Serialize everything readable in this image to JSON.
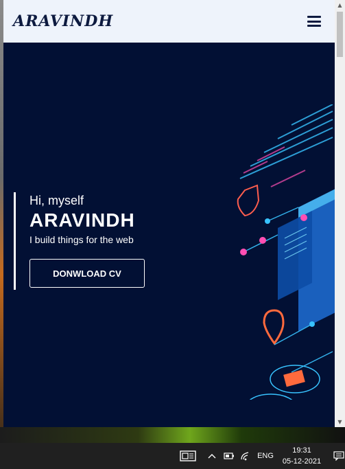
{
  "navbar": {
    "brand": "ARAVINDH",
    "menu_icon": "hamburger-menu-icon"
  },
  "hero": {
    "greeting": "Hi, myself",
    "name": "ARAVINDH",
    "tagline": "I build things for the web",
    "cv_button_label": "DONWLOAD CV",
    "illustration": "isometric-tech-illustration"
  },
  "taskbar": {
    "news_icon": "news-widget-icon",
    "tray_chevron_icon": "chevron-up-icon",
    "battery_icon": "battery-icon",
    "wifi_icon": "wifi-icon",
    "language": "ENG",
    "time": "19:31",
    "date": "05-12-2021",
    "notification_icon": "notification-icon"
  },
  "colors": {
    "hero_background": "#021034",
    "navbar_background": "#eef3fb",
    "brand_text": "#0d1a3f",
    "accent_cyan": "#38c3ff",
    "accent_pink": "#ff4fb3",
    "accent_orange": "#ff6a3d",
    "taskbar": "#202020"
  }
}
